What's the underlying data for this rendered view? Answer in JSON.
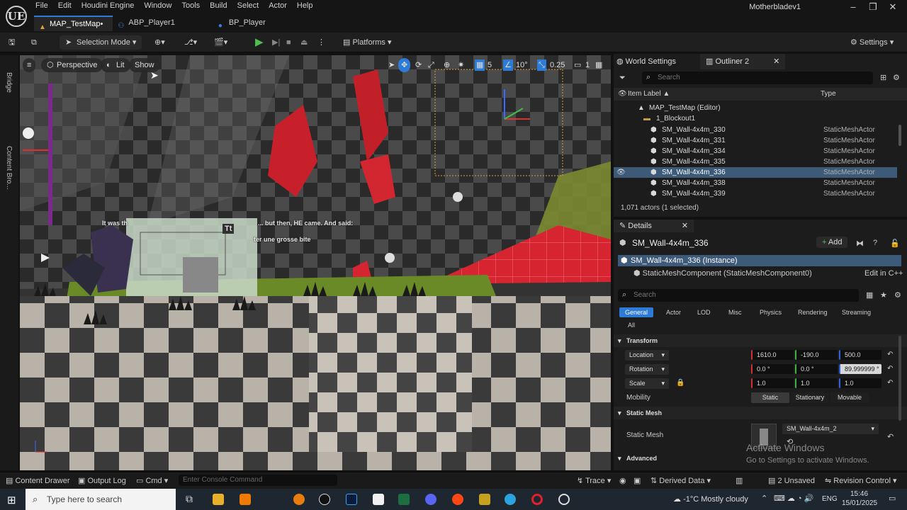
{
  "app": {
    "logo": "UE",
    "user": "Motherbladev1",
    "menu": [
      "File",
      "Edit",
      "Houdini Engine",
      "Window",
      "Tools",
      "Build",
      "Select",
      "Actor",
      "Help"
    ],
    "tabs": [
      {
        "label": "MAP_TestMap•",
        "icon": "map-icon"
      },
      {
        "label": "ABP_Player1",
        "icon": "anim-blueprint-icon"
      },
      {
        "label": "BP_Player",
        "icon": "blueprint-icon"
      }
    ]
  },
  "toolbar": {
    "selection_mode": "Selection Mode",
    "platforms": "Platforms",
    "settings": "Settings"
  },
  "viewport": {
    "perspective": "Perspective",
    "lit": "Lit",
    "show": "Show",
    "grid_value": "5",
    "rot_value": "10°",
    "scale_value": "0.25",
    "cam_speed": "1",
    "subtitle_left": "It was th",
    "subtitle_mid": "... but then, HE came. And said:",
    "subtitle_line2": "ter une grosse bite",
    "text_tool": "Tt"
  },
  "left_strip": {
    "bridge": "Bridge",
    "content_browser": "Content Bro..."
  },
  "outliner": {
    "tab_world": "World Settings",
    "tab_outliner": "Outliner 2",
    "search_placeholder": "Search",
    "col_label": "Item Label ▲",
    "col_type": "Type",
    "map_row": "MAP_TestMap (Editor)",
    "folder_row": "1_Blockout1",
    "rows": [
      {
        "label": "SM_Wall-4x4m_330",
        "type": "StaticMeshActor"
      },
      {
        "label": "SM_Wall-4x4m_331",
        "type": "StaticMeshActor"
      },
      {
        "label": "SM_Wall-4x4m_334",
        "type": "StaticMeshActor"
      },
      {
        "label": "SM_Wall-4x4m_335",
        "type": "StaticMeshActor"
      },
      {
        "label": "SM_Wall-4x4m_336",
        "type": "StaticMeshActor",
        "selected": true
      },
      {
        "label": "SM_Wall-4x4m_338",
        "type": "StaticMeshActor"
      },
      {
        "label": "SM_Wall-4x4m_339",
        "type": "StaticMeshActor"
      }
    ],
    "count": "1,071 actors (1 selected)"
  },
  "details": {
    "tab": "Details",
    "actor_name": "SM_Wall-4x4m_336",
    "add": "Add",
    "instance": "SM_Wall-4x4m_336 (Instance)",
    "component": "StaticMeshComponent (StaticMeshComponent0)",
    "edit_cpp": "Edit in C++",
    "search_placeholder": "Search",
    "filters": [
      "General",
      "Actor",
      "LOD",
      "Misc",
      "Physics",
      "Rendering",
      "Streaming",
      "All"
    ],
    "transform_header": "Transform",
    "location": {
      "label": "Location",
      "x": "1610.0",
      "y": "-190.0",
      "z": "500.0"
    },
    "rotation": {
      "label": "Rotation",
      "x": "0.0 °",
      "y": "0.0 °",
      "z": "89.999999 °"
    },
    "scale": {
      "label": "Scale",
      "x": "1.0",
      "y": "1.0",
      "z": "1.0"
    },
    "mobility": {
      "label": "Mobility",
      "options": [
        "Static",
        "Stationary",
        "Movable"
      ],
      "selected": "Static"
    },
    "static_mesh_header": "Static Mesh",
    "static_mesh_label": "Static Mesh",
    "static_mesh_value": "SM_Wall-4x4m_2",
    "advanced": "Advanced"
  },
  "watermark": {
    "line1": "Activate Windows",
    "line2": "Go to Settings to activate Windows."
  },
  "statusbar": {
    "content_drawer": "Content Drawer",
    "output_log": "Output Log",
    "cmd": "Cmd",
    "console_placeholder": "Enter Console Command",
    "trace": "Trace",
    "derived_data": "Derived Data",
    "unsaved": "2 Unsaved",
    "revision": "Revision Control"
  },
  "taskbar": {
    "search": "Type here to search",
    "weather": "-1°C  Mostly cloudy",
    "lang": "ENG",
    "time": "15:46",
    "date": "15/01/2025"
  },
  "colors": {
    "accent": "#2d7bd6",
    "selected_row": "#3d5a78",
    "red_block": "#c8202a",
    "grass": "#6f8a2a"
  }
}
